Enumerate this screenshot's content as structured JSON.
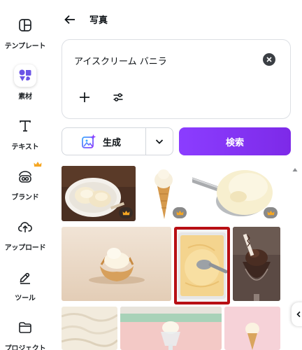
{
  "sidebar": {
    "items": [
      {
        "label": "テンプレート",
        "icon": "template-icon"
      },
      {
        "label": "素材",
        "icon": "elements-icon",
        "active": true
      },
      {
        "label": "テキスト",
        "icon": "text-icon"
      },
      {
        "label": "ブランド",
        "icon": "brand-icon",
        "premium": true
      },
      {
        "label": "アップロード",
        "icon": "upload-icon"
      },
      {
        "label": "ツール",
        "icon": "tools-icon"
      },
      {
        "label": "プロジェクト",
        "icon": "folder-icon"
      }
    ]
  },
  "header": {
    "title": "写真",
    "back_icon": "arrow-left-icon"
  },
  "search": {
    "value": "アイスクリーム バニラ",
    "clear_icon": "clear-icon"
  },
  "toolbar": {
    "add_icon": "plus-icon",
    "filter_icon": "filter-icon"
  },
  "actions": {
    "generate_label": "生成",
    "search_label": "検索"
  },
  "colors": {
    "accent": "#8b3dff",
    "selection": "#b80f14",
    "crown": "#f5a623"
  },
  "gallery": {
    "images": [
      {
        "subject": "two scoops of vanilla ice cream in a bowl",
        "premium": true
      },
      {
        "subject": "vanilla ice cream cone",
        "premium": true
      },
      {
        "subject": "ice cream scoop with vanilla ice cream",
        "premium": true
      },
      {
        "subject": "vanilla ice cream in a waffle basket",
        "premium": false
      },
      {
        "subject": "scooping vanilla ice cream from a tub",
        "premium": false,
        "selected": true
      },
      {
        "subject": "chocolate ice cream sundae in a glass",
        "premium": false
      },
      {
        "subject": "whipped vanilla ice cream texture",
        "premium": false
      },
      {
        "subject": "ice cream in a glass on pastel background",
        "premium": false
      },
      {
        "subject": "ice cream on pink background",
        "premium": false
      }
    ]
  }
}
